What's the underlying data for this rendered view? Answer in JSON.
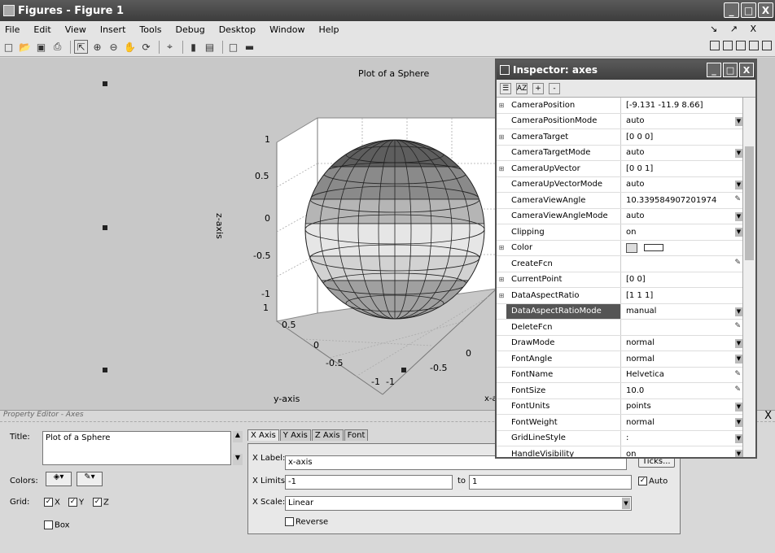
{
  "window": {
    "title": "Figures - Figure 1",
    "buttons": [
      "_",
      "□",
      "X"
    ]
  },
  "menu": {
    "items": [
      "File",
      "Edit",
      "View",
      "Insert",
      "Tools",
      "Debug",
      "Desktop",
      "Window",
      "Help"
    ],
    "dock": "↘ ↗ X"
  },
  "toolbar": {
    "icons": [
      "new-file-icon",
      "open-icon",
      "save-icon",
      "print-icon",
      "pointer-icon",
      "zoom-in-icon",
      "zoom-out-icon",
      "pan-icon",
      "rotate-icon",
      "data-cursor-icon",
      "colorbar-icon",
      "legend-icon",
      "hide-plot-tools-icon",
      "show-plot-tools-icon"
    ]
  },
  "plot": {
    "title": "Plot of a Sphere",
    "ylabel": "y-axis",
    "zlabel": "z-axis",
    "xlabel_partial": "x-a",
    "z_ticks": [
      "1",
      "0.5",
      "0",
      "-0.5",
      "-1"
    ],
    "y_ticks": [
      "1",
      "0.5",
      "0",
      "-0.5",
      "-1"
    ],
    "x_ticks": [
      "-1",
      "-0.5",
      "0"
    ]
  },
  "inspector": {
    "title": "Inspector:  axes",
    "properties": [
      {
        "name": "CameraPosition",
        "value": "[-9.131 -11.9 8.66]",
        "expand": true,
        "ctl": ""
      },
      {
        "name": "CameraPositionMode",
        "value": "auto",
        "expand": false,
        "ctl": "dd"
      },
      {
        "name": "CameraTarget",
        "value": "[0 0 0]",
        "expand": true,
        "ctl": ""
      },
      {
        "name": "CameraTargetMode",
        "value": "auto",
        "expand": false,
        "ctl": "dd"
      },
      {
        "name": "CameraUpVector",
        "value": "[0 0 1]",
        "expand": true,
        "ctl": ""
      },
      {
        "name": "CameraUpVectorMode",
        "value": "auto",
        "expand": false,
        "ctl": "dd"
      },
      {
        "name": "CameraViewAngle",
        "value": "10.339584907201974",
        "expand": false,
        "ctl": "ed"
      },
      {
        "name": "CameraViewAngleMode",
        "value": "auto",
        "expand": false,
        "ctl": "dd"
      },
      {
        "name": "Clipping",
        "value": "on",
        "expand": false,
        "ctl": "dd"
      },
      {
        "name": "Color",
        "value": "",
        "expand": true,
        "ctl": "color"
      },
      {
        "name": "CreateFcn",
        "value": "",
        "expand": false,
        "ctl": "ed"
      },
      {
        "name": "CurrentPoint",
        "value": "[0 0]",
        "expand": true,
        "ctl": ""
      },
      {
        "name": "DataAspectRatio",
        "value": "[1 1 1]",
        "expand": true,
        "ctl": ""
      },
      {
        "name": "DataAspectRatioMode",
        "value": "manual",
        "expand": false,
        "ctl": "dd",
        "selected": true
      },
      {
        "name": "DeleteFcn",
        "value": "",
        "expand": false,
        "ctl": "ed"
      },
      {
        "name": "DrawMode",
        "value": "normal",
        "expand": false,
        "ctl": "dd"
      },
      {
        "name": "FontAngle",
        "value": "normal",
        "expand": false,
        "ctl": "dd"
      },
      {
        "name": "FontName",
        "value": "Helvetica",
        "expand": false,
        "ctl": "ed"
      },
      {
        "name": "FontSize",
        "value": "10.0",
        "expand": false,
        "ctl": "ed"
      },
      {
        "name": "FontUnits",
        "value": "points",
        "expand": false,
        "ctl": "dd"
      },
      {
        "name": "FontWeight",
        "value": "normal",
        "expand": false,
        "ctl": "dd"
      },
      {
        "name": "GridLineStyle",
        "value": ":",
        "expand": false,
        "ctl": "dd"
      },
      {
        "name": "HandleVisibility",
        "value": "on",
        "expand": false,
        "ctl": "dd"
      }
    ]
  },
  "property_editor": {
    "header": "Property Editor - Axes",
    "title_label": "Title:",
    "title_value": "Plot of a Sphere",
    "colors_label": "Colors:",
    "grid_label": "Grid:",
    "grid_x": "X",
    "grid_y": "Y",
    "grid_z": "Z",
    "box_label": "Box",
    "tabs": [
      "X Axis",
      "Y Axis",
      "Z Axis",
      "Font"
    ],
    "xlabel_label": "X Label:",
    "xlabel_value": "x-axis",
    "xlimits_label": "X Limits:",
    "xlim_min": "-1",
    "to_label": "to",
    "xlim_max": "1",
    "xscale_label": "X Scale:",
    "xscale_value": "Linear",
    "reverse_label": "Reverse",
    "ticks_button": "Ticks...",
    "auto_label": "Auto",
    "close": "X"
  }
}
